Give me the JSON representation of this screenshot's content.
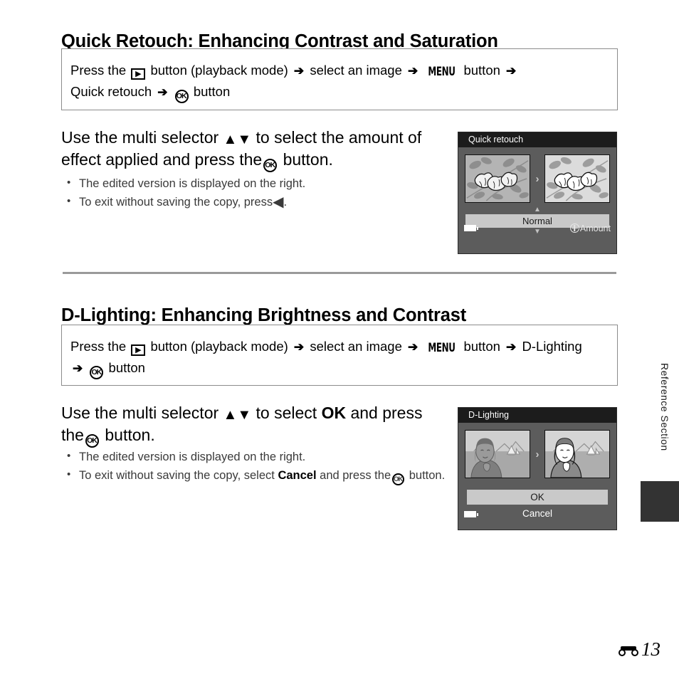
{
  "page": {
    "number": "13",
    "section_marker_icon": "e-reference-icon",
    "side_tab_label": "Reference Section"
  },
  "sections": [
    {
      "id": "quick-retouch",
      "heading": "Quick Retouch: Enhancing Contrast and Saturation",
      "path": {
        "line1": {
          "press_the": "Press the",
          "play_icon": "playback-icon",
          "button_playback": "button (playback mode)",
          "arrow1": "➔",
          "select_image": "select an image",
          "arrow2": "➔",
          "menu_glyph": "MENU",
          "button_word": "button",
          "arrow3": "➔"
        },
        "line2": {
          "item": "Quick retouch",
          "arrow": "➔",
          "ok_icon": "OK",
          "button_word": "button"
        }
      },
      "step": {
        "title_part1": "Use the multi selector",
        "title_triangles": "▲▼",
        "title_part2": "to select the amount of effect applied and press the",
        "title_ok": "OK",
        "title_part3": "button."
      },
      "bullets": [
        {
          "text": "The edited version is displayed on the right."
        },
        {
          "text_before": "To exit without saving the copy, press",
          "glyph": "◀",
          "text_after": "."
        }
      ],
      "screen": {
        "title": "Quick retouch",
        "selected_value": "Normal",
        "caret_up": "▲",
        "caret_down": "▼",
        "footer_hint": "Amount",
        "battery_icon": "battery-icon",
        "multiselector_icon": "multi-selector-icon",
        "thumb_arrow": "›",
        "thumb_left_name": "original-flowers-thumbnail",
        "thumb_right_name": "retouched-flowers-thumbnail"
      }
    },
    {
      "id": "d-lighting",
      "heading": "D-Lighting: Enhancing Brightness and Contrast",
      "path": {
        "line1": {
          "press_the": "Press the",
          "play_icon": "playback-icon",
          "button_playback": "button (playback mode)",
          "arrow1": "➔",
          "select_image": "select an image",
          "arrow2": "➔",
          "menu_glyph": "MENU",
          "button_word": "button",
          "arrow3": "➔",
          "item": "D-Lighting"
        },
        "line2": {
          "arrow": "➔",
          "ok_icon": "OK",
          "button_word": "button"
        }
      },
      "step": {
        "title_part1": "Use the multi selector",
        "title_triangles": "▲▼",
        "title_part2": "to select",
        "title_bold": "OK",
        "title_part2b": "and press the",
        "title_ok": "OK",
        "title_part3": "button."
      },
      "bullets": [
        {
          "text": "The edited version is displayed on the right."
        },
        {
          "text_before": "To exit without saving the copy, select",
          "bold": "Cancel",
          "text_mid": "and press the",
          "ok_icon": "OK",
          "text_after": "button."
        }
      ],
      "screen": {
        "title": "D-Lighting",
        "option_selected": "OK",
        "option_other": "Cancel",
        "battery_icon": "battery-icon",
        "thumb_arrow": "›",
        "thumb_left_name": "original-portrait-thumbnail",
        "thumb_right_name": "dlighting-portrait-thumbnail"
      }
    }
  ],
  "colors": {
    "screen_header": "#1c1c1c",
    "screen_body": "#5c5c5c",
    "screen_selected_bar": "#c9c9c9",
    "box_border": "#8c8c8c",
    "divider": "#9a9a9a",
    "tab_block": "#333333"
  }
}
